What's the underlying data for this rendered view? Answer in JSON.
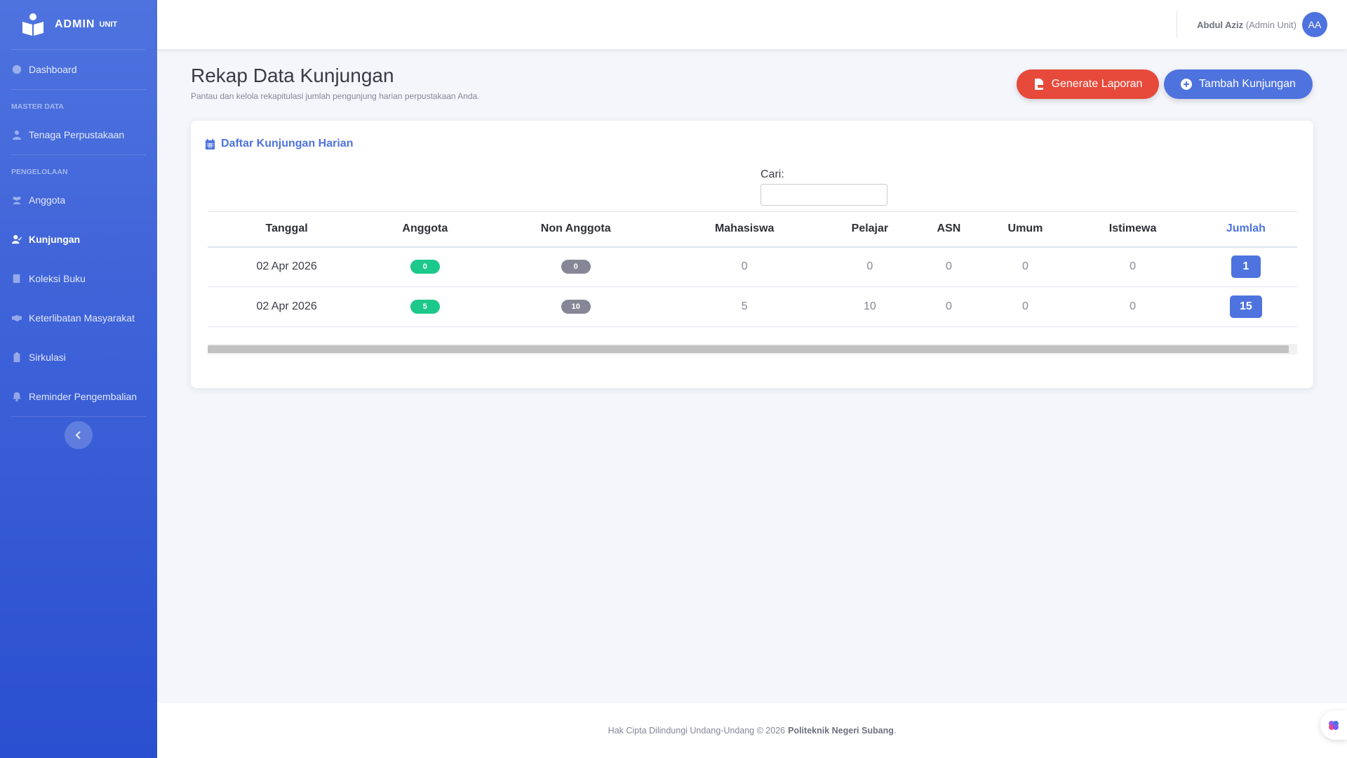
{
  "brand": {
    "name": "ADMIN",
    "sup": "UNIT"
  },
  "sidebar": {
    "items": [
      {
        "label": "Dashboard",
        "icon": "dashboard-icon"
      },
      {
        "section": "MASTER DATA"
      },
      {
        "label": "Tenaga Perpustakaan",
        "icon": "user-icon"
      },
      {
        "section": "PENGELOLAAN"
      },
      {
        "label": "Anggota",
        "icon": "users-icon"
      },
      {
        "label": "Kunjungan",
        "icon": "user-check-icon",
        "active": true
      },
      {
        "label": "Koleksi Buku",
        "icon": "book-icon"
      },
      {
        "label": "Keterlibatan Masyarakat",
        "icon": "handshake-icon"
      },
      {
        "label": "Sirkulasi",
        "icon": "clipboard-icon"
      },
      {
        "label": "Reminder Pengembalian",
        "icon": "bell-icon"
      }
    ]
  },
  "topbar": {
    "user_name": "Abdul Aziz",
    "user_role": "(Admin Unit)",
    "avatar_initials": "AA"
  },
  "page": {
    "title": "Rekap Data Kunjungan",
    "subtitle": "Pantau dan kelola rekapitulasi jumlah pengunjung harian perpustakaan Anda.",
    "btn_report": "Generate Laporan",
    "btn_add": "Tambah Kunjungan"
  },
  "card": {
    "title": "Daftar Kunjungan Harian",
    "search_label": "Cari:",
    "search_value": "",
    "columns": [
      "Tanggal",
      "Anggota",
      "Non Anggota",
      "Mahasiswa",
      "Pelajar",
      "ASN",
      "Umum",
      "Istimewa",
      "Jumlah"
    ],
    "rows": [
      [
        "02 Apr 2026",
        "0",
        "0",
        "0",
        "0",
        "0",
        "0",
        "0",
        "1"
      ],
      [
        "02 Apr 2026",
        "5",
        "10",
        "5",
        "10",
        "0",
        "0",
        "0",
        "15"
      ]
    ]
  },
  "footer": {
    "text": "Hak Cipta Dilindungi Undang-Undang © 2026",
    "org": "Politeknik Negeri Subang",
    "end": "."
  },
  "colors": {
    "primary": "#4e73df",
    "danger": "#e74a3b",
    "success": "#1cc88a",
    "secondary": "#858796"
  }
}
